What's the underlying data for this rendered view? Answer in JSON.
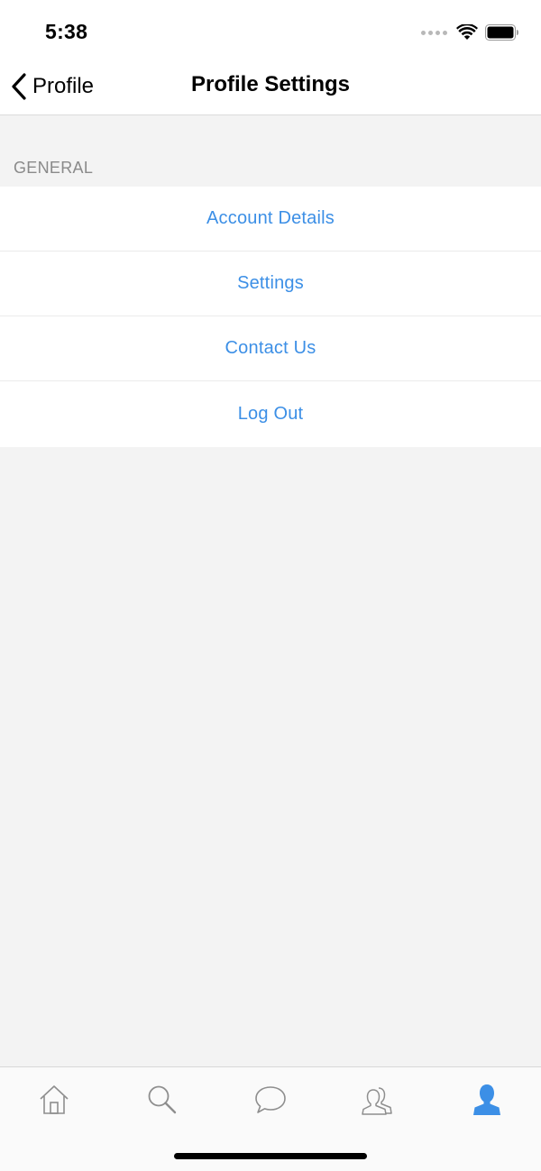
{
  "status_bar": {
    "time": "5:38"
  },
  "nav": {
    "back_label": "Profile",
    "title": "Profile Settings"
  },
  "section": {
    "header": "GENERAL",
    "items": [
      {
        "label": "Account Details"
      },
      {
        "label": "Settings"
      },
      {
        "label": "Contact Us"
      },
      {
        "label": "Log Out"
      }
    ]
  },
  "tabbar": {
    "tabs": [
      {
        "icon": "home-icon",
        "active": false
      },
      {
        "icon": "search-icon",
        "active": false
      },
      {
        "icon": "chat-bubble-icon",
        "active": false
      },
      {
        "icon": "friends-icon",
        "active": false
      },
      {
        "icon": "profile-icon",
        "active": true
      }
    ]
  },
  "colors": {
    "accent": "#3c8fe6",
    "inactive_icon": "#8e8e8e",
    "background": "#f3f3f3"
  }
}
